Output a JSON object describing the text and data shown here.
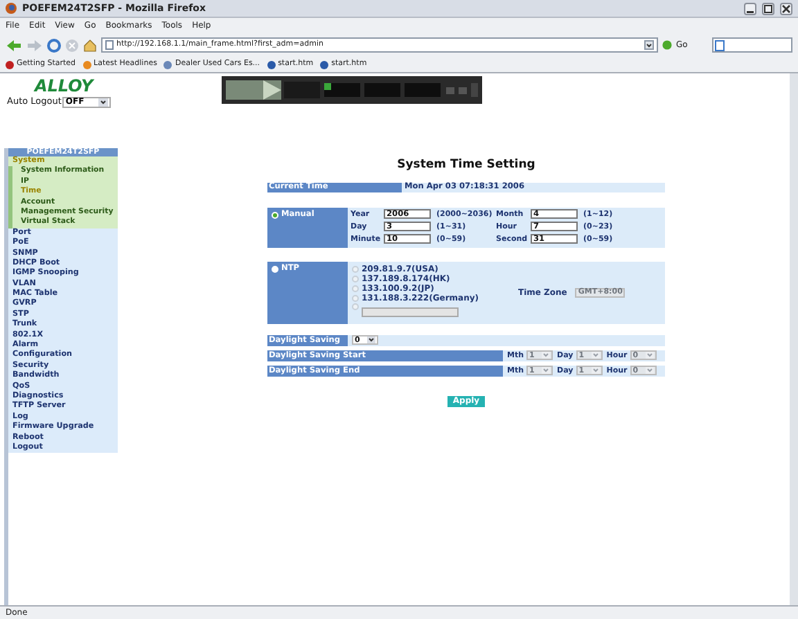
{
  "window": {
    "title": "POEFEM24T2SFP - Mozilla Firefox"
  },
  "menu": [
    "File",
    "Edit",
    "View",
    "Go",
    "Bookmarks",
    "Tools",
    "Help"
  ],
  "address_bar": {
    "url": "http://192.168.1.1/main_frame.html?first_adm=admin",
    "go": "Go"
  },
  "bookmarks": [
    "Getting Started",
    "Latest Headlines",
    "Dealer Used Cars Es...",
    "start.htm",
    "start.htm"
  ],
  "page": {
    "logo": "ALLOY",
    "auto_logout": {
      "label": "Auto Logout",
      "value": "OFF"
    },
    "sidebar": {
      "title": "POEFEM24T2SFP",
      "items": [
        {
          "label": "System",
          "expanded": true,
          "selected": true,
          "children": [
            {
              "label": "System Information",
              "selected": false
            },
            {
              "label": "IP",
              "selected": false
            },
            {
              "label": "Time",
              "selected": true
            },
            {
              "label": "Account",
              "selected": false
            },
            {
              "label": "Management Security",
              "selected": false
            },
            {
              "label": "Virtual Stack",
              "selected": false
            }
          ]
        },
        {
          "label": "Port",
          "selected": false
        },
        {
          "label": "PoE",
          "selected": false
        },
        {
          "label": "SNMP",
          "selected": false
        },
        {
          "label": "DHCP Boot",
          "selected": false
        },
        {
          "label": "IGMP Snooping",
          "selected": false
        },
        {
          "label": "VLAN",
          "selected": false
        },
        {
          "label": "MAC Table",
          "selected": false
        },
        {
          "label": "GVRP",
          "selected": false
        },
        {
          "label": "STP",
          "selected": false
        },
        {
          "label": "Trunk",
          "selected": false
        },
        {
          "label": "802.1X",
          "selected": false
        },
        {
          "label": "Alarm",
          "selected": false
        },
        {
          "label": "Configuration",
          "selected": false
        },
        {
          "label": "Security",
          "selected": false
        },
        {
          "label": "Bandwidth",
          "selected": false
        },
        {
          "label": "QoS",
          "selected": false
        },
        {
          "label": "Diagnostics",
          "selected": false
        },
        {
          "label": "TFTP Server",
          "selected": false
        },
        {
          "label": "Log",
          "selected": false
        },
        {
          "label": "Firmware Upgrade",
          "selected": false
        },
        {
          "label": "Reboot",
          "selected": false
        },
        {
          "label": "Logout",
          "selected": false
        }
      ]
    },
    "heading": "System Time Setting",
    "current_time": {
      "label": "Current Time",
      "value": "Mon Apr 03 07:18:31 2006"
    },
    "manual": {
      "label": "Manual",
      "selected": true,
      "fields": [
        {
          "label": "Year",
          "value": "2006",
          "range": "(2000~2036)"
        },
        {
          "label": "Month",
          "value": "4",
          "range": "(1~12)"
        },
        {
          "label": "Day",
          "value": "3",
          "range": "(1~31)"
        },
        {
          "label": "Hour",
          "value": "7",
          "range": "(0~23)"
        },
        {
          "label": "Minute",
          "value": "10",
          "range": "(0~59)"
        },
        {
          "label": "Second",
          "value": "31",
          "range": "(0~59)"
        }
      ]
    },
    "ntp": {
      "label": "NTP",
      "selected": false,
      "servers": [
        {
          "label": "209.81.9.7(USA)",
          "selected": false,
          "disabled": true
        },
        {
          "label": "137.189.8.174(HK)",
          "selected": false,
          "disabled": true
        },
        {
          "label": "133.100.9.2(JP)",
          "selected": false,
          "disabled": true
        },
        {
          "label": "131.188.3.222(Germany)",
          "selected": false,
          "disabled": true
        }
      ],
      "custom": {
        "selected": false,
        "disabled": true
      },
      "time_zone": {
        "label": "Time Zone",
        "value": "GMT+8:00",
        "disabled": true
      }
    },
    "daylight_saving": {
      "label": "Daylight Saving",
      "value": "0"
    },
    "daylight_rows": [
      {
        "label": "Daylight Saving Start",
        "selects": [
          {
            "label": "Mth",
            "value": "1",
            "disabled": true
          },
          {
            "label": "Day",
            "value": "1",
            "disabled": true
          },
          {
            "label": "Hour",
            "value": "0",
            "disabled": true
          }
        ]
      },
      {
        "label": "Daylight Saving End",
        "selects": [
          {
            "label": "Mth",
            "value": "1",
            "disabled": true
          },
          {
            "label": "Day",
            "value": "1",
            "disabled": true
          },
          {
            "label": "Hour",
            "value": "0",
            "disabled": true
          }
        ]
      }
    ],
    "apply": "Apply"
  },
  "status_bar": "Done"
}
